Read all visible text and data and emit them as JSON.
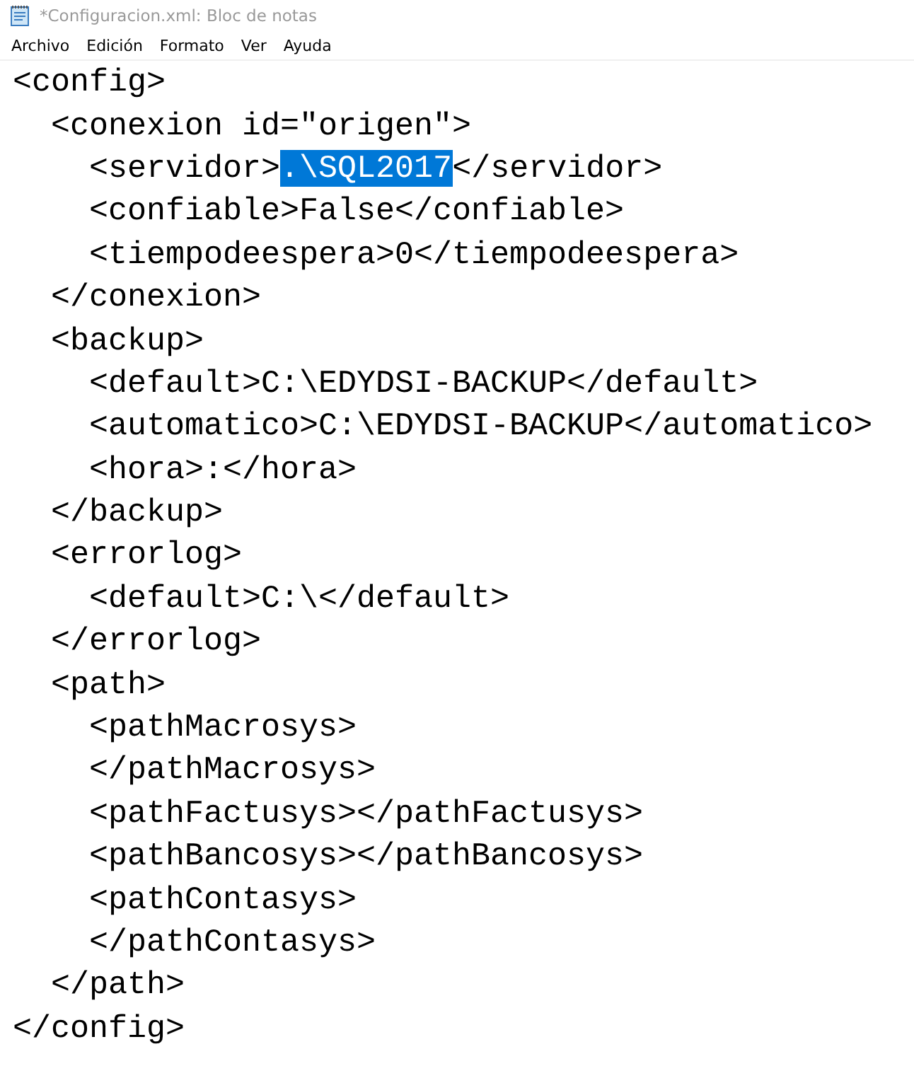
{
  "window": {
    "title": "*Configuracion.xml: Bloc de notas"
  },
  "menu": [
    "Archivo",
    "Edición",
    "Formato",
    "Ver",
    "Ayuda"
  ],
  "lines": [
    {
      "text": "<config>",
      "children": [
        {
          "text": "<conexion id=\"origen\">",
          "children": [
            {
              "before": "<servidor>",
              "selection": ".\\SQL2017",
              "after": "</servidor>"
            },
            {
              "text": "<confiable>False</confiable>"
            },
            {
              "text": "<tiempodeespera>0</tiempodeespera>"
            }
          ]
        },
        {
          "text": "</conexion>"
        },
        {
          "text": "<backup>",
          "children": [
            {
              "text": "<default>C:\\EDYDSI-BACKUP</default>"
            },
            {
              "text": "<automatico>C:\\EDYDSI-BACKUP</automatico>"
            },
            {
              "text": "<hora>:</hora>"
            }
          ]
        },
        {
          "text": "</backup>"
        },
        {
          "text": "<errorlog>",
          "children": [
            {
              "text": "<default>C:\\</default>"
            }
          ]
        },
        {
          "text": "</errorlog>"
        },
        {
          "text": "<path>",
          "children": [
            {
              "text": "<pathMacrosys>"
            },
            {
              "text": "</pathMacrosys>"
            },
            {
              "text": "<pathFactusys></pathFactusys>"
            },
            {
              "text": "<pathBancosys></pathBancosys>"
            },
            {
              "text": "<pathContasys>"
            },
            {
              "text": "</pathContasys>"
            }
          ]
        },
        {
          "text": "</path>"
        }
      ]
    },
    {
      "text": "</config>"
    }
  ]
}
